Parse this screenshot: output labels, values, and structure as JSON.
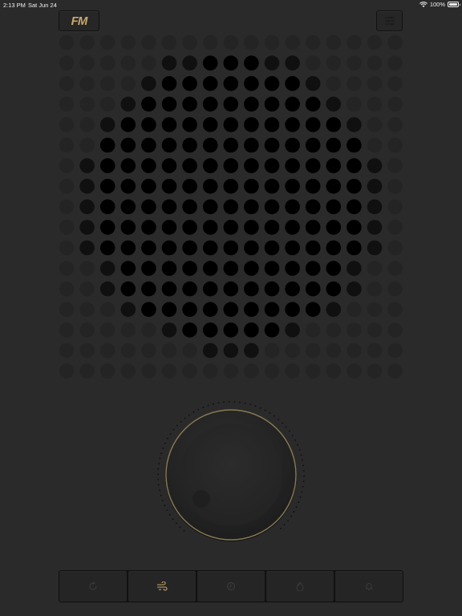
{
  "status_bar": {
    "time": "2:13 PM",
    "date": "Sat Jun 24",
    "battery": "100%"
  },
  "header": {
    "logo_text": "FM",
    "logo_color": "#c9a86a",
    "menu_icon": "sliders-icon"
  },
  "speaker": {
    "grid_cols": 17,
    "grid_rows": 17
  },
  "knob": {
    "ring_color": "#8a7a55"
  },
  "bottom_bar": {
    "buttons": [
      {
        "icon": "refresh-icon",
        "active": false
      },
      {
        "icon": "wind-icon",
        "active": true
      },
      {
        "icon": "timer-icon",
        "active": false
      },
      {
        "icon": "flame-icon",
        "active": false
      },
      {
        "icon": "bell-icon",
        "active": false
      }
    ]
  }
}
